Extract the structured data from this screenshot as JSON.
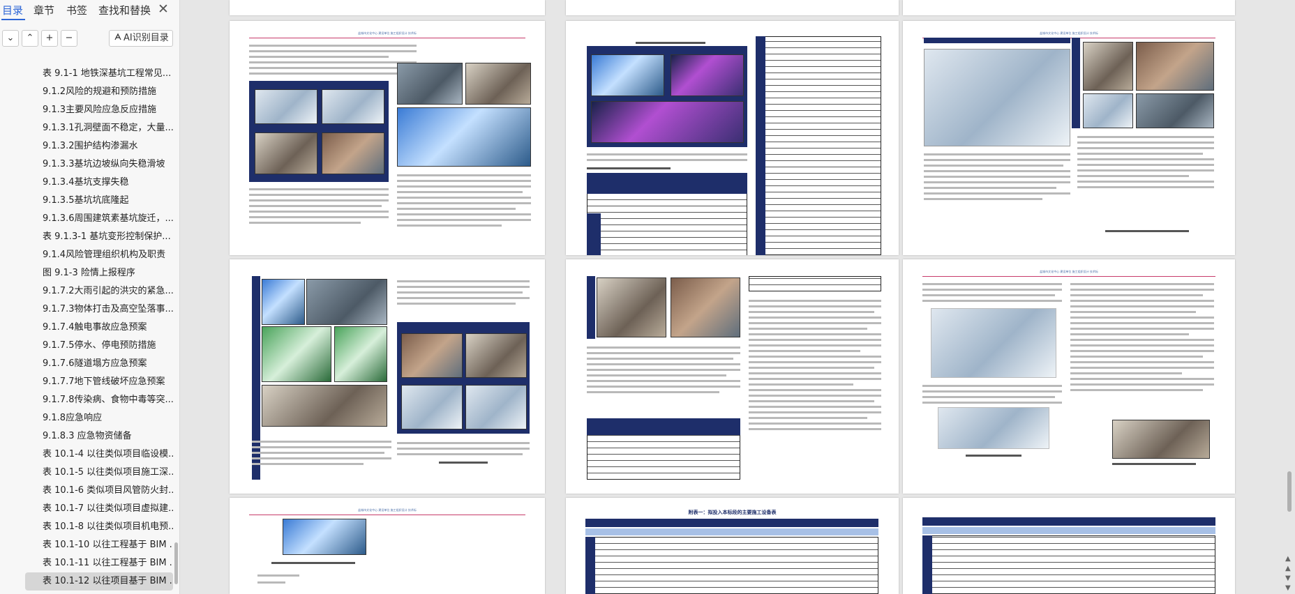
{
  "panel": {
    "tabs": [
      {
        "label": "目录"
      },
      {
        "label": "章节"
      },
      {
        "label": "书签"
      },
      {
        "label": "查找和替换"
      }
    ],
    "close_glyph": "✕",
    "toolbar": {
      "collapse_glyph": "⌄",
      "expand_glyph": "⌃",
      "add_glyph": "+",
      "remove_glyph": "−",
      "ai_label": "AI识别目录"
    },
    "toc": [
      {
        "label": "表 9.1-1 地铁深基坑工程常见..."
      },
      {
        "label": "9.1.2风险的规避和预防措施"
      },
      {
        "label": "9.1.3主要风险应急反应措施"
      },
      {
        "label": "9.1.3.1孔洞壁面不稳定，大量..."
      },
      {
        "label": "9.1.3.2围护结构渗漏水"
      },
      {
        "label": "9.1.3.3基坑边坡纵向失稳滑坡"
      },
      {
        "label": "9.1.3.4基坑支撑失稳"
      },
      {
        "label": "9.1.3.5基坑坑底隆起"
      },
      {
        "label": "9.1.3.6周围建筑素基坑旋迁，..."
      },
      {
        "label": "表 9.1.3-1 基坑变形控制保护..."
      },
      {
        "label": "9.1.4风险管理组织机构及职责"
      },
      {
        "label": "图 9.1-3 险情上报程序"
      },
      {
        "label": "9.1.7.2大雨引起的洪灾的紧急..."
      },
      {
        "label": "9.1.7.3物体打击及高空坠落事..."
      },
      {
        "label": "9.1.7.4触电事故应急预案"
      },
      {
        "label": "9.1.7.5停水、停电预防措施"
      },
      {
        "label": "9.1.7.6隧道塌方应急预案"
      },
      {
        "label": "9.1.7.7地下管线破坏应急预案"
      },
      {
        "label": "9.1.7.8传染病、食物中毒等突..."
      },
      {
        "label": "9.1.8应急响应"
      },
      {
        "label": "9.1.8.3 应急物资储备"
      },
      {
        "label": "表 10.1-4 以往类似项目临设模..."
      },
      {
        "label": "表 10.1-5 以往类似项目施工深..."
      },
      {
        "label": "表 10.1-6 类似项目风管防火封..."
      },
      {
        "label": "表 10.1-7 以往类似项目虚拟建..."
      },
      {
        "label": "表 10.1-8 以往类似项目机电预..."
      },
      {
        "label": "表 10.1-10 以往工程基于 BIM ..."
      },
      {
        "label": "表 10.1-11 以往工程基于 BIM ..."
      },
      {
        "label": "表 10.1-12 以往项目基于 BIM ..."
      }
    ]
  },
  "document": {
    "header_text": "盐城市文化中心 建设单位 施工组织设计 技术标",
    "table_title": "附表一：拟投入本标段的主要施工设备表"
  },
  "colors": {
    "accent": "#2b64d6",
    "header_rule": "#c73a6a",
    "table_dark": "#1e2e6a"
  }
}
